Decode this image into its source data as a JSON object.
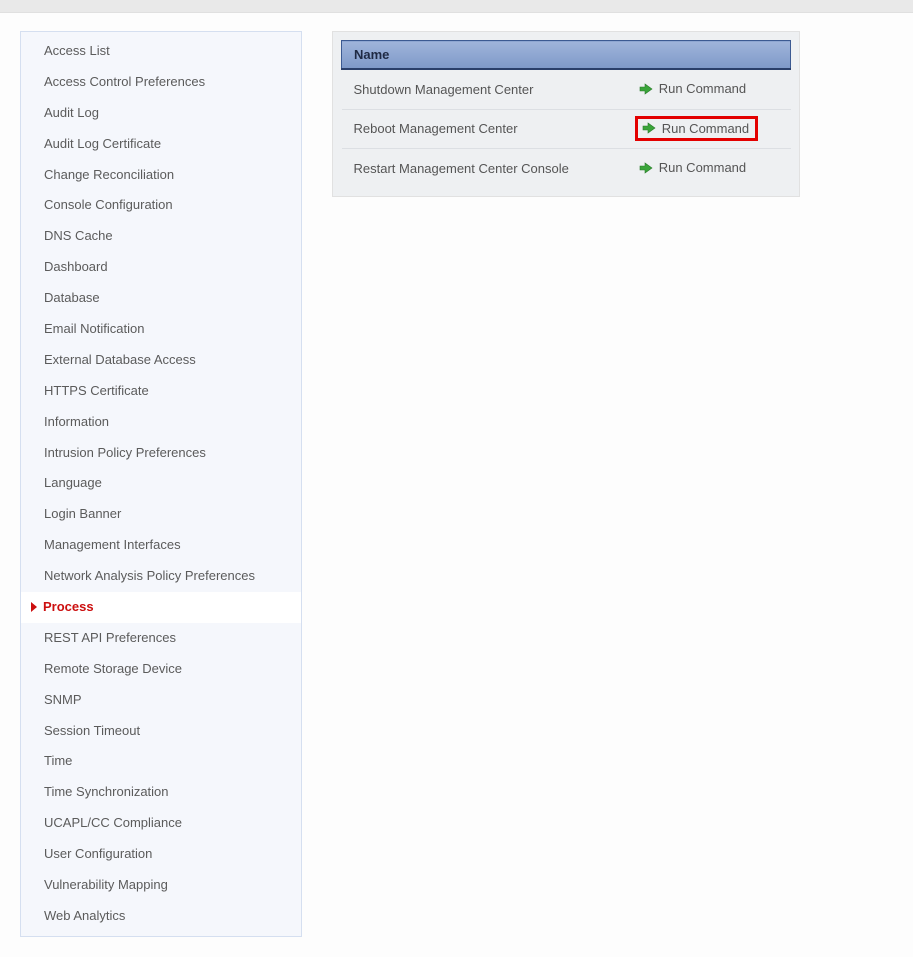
{
  "sidebar": {
    "items": [
      {
        "label": "Access List"
      },
      {
        "label": "Access Control Preferences"
      },
      {
        "label": "Audit Log"
      },
      {
        "label": "Audit Log Certificate"
      },
      {
        "label": "Change Reconciliation"
      },
      {
        "label": "Console Configuration"
      },
      {
        "label": "DNS Cache"
      },
      {
        "label": "Dashboard"
      },
      {
        "label": "Database"
      },
      {
        "label": "Email Notification"
      },
      {
        "label": "External Database Access"
      },
      {
        "label": "HTTPS Certificate"
      },
      {
        "label": "Information"
      },
      {
        "label": "Intrusion Policy Preferences"
      },
      {
        "label": "Language"
      },
      {
        "label": "Login Banner"
      },
      {
        "label": "Management Interfaces"
      },
      {
        "label": "Network Analysis Policy Preferences"
      },
      {
        "label": "Process",
        "active": true
      },
      {
        "label": "REST API Preferences"
      },
      {
        "label": "Remote Storage Device"
      },
      {
        "label": "SNMP"
      },
      {
        "label": "Session Timeout"
      },
      {
        "label": "Time"
      },
      {
        "label": "Time Synchronization"
      },
      {
        "label": "UCAPL/CC Compliance"
      },
      {
        "label": "User Configuration"
      },
      {
        "label": "Vulnerability Mapping"
      },
      {
        "label": "Web Analytics"
      }
    ]
  },
  "table": {
    "header": {
      "name": "Name"
    },
    "run_label": "Run Command",
    "rows": [
      {
        "name": "Shutdown Management Center",
        "highlight": false
      },
      {
        "name": "Reboot Management Center",
        "highlight": true
      },
      {
        "name": "Restart Management Center Console",
        "highlight": false
      }
    ]
  }
}
